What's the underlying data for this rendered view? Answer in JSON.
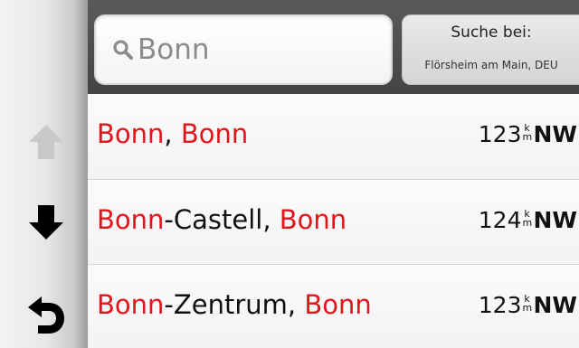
{
  "search": {
    "query": "Bonn",
    "near_label": "Suche bei:",
    "near_value": "Flörsheim am Main, DEU"
  },
  "nav": {
    "up_icon": "arrow-up-icon",
    "down_icon": "arrow-down-icon",
    "back_icon": "back-icon"
  },
  "results": [
    {
      "name_hl_1": "Bonn",
      "name_sep": ", ",
      "name_hl_2": "Bonn",
      "distance": "123",
      "unit_top": "k",
      "unit_bottom": "m",
      "direction": "NW"
    },
    {
      "name_hl_1": "Bonn",
      "name_sep": "-Castell, ",
      "name_hl_2": "Bonn",
      "distance": "124",
      "unit_top": "k",
      "unit_bottom": "m",
      "direction": "NW"
    },
    {
      "name_hl_1": "Bonn",
      "name_sep": "-Zentrum, ",
      "name_hl_2": "Bonn",
      "distance": "123",
      "unit_top": "k",
      "unit_bottom": "m",
      "direction": "NW"
    }
  ],
  "colors": {
    "highlight": "#e2151b",
    "topbar": "#4a4a4a",
    "disabled_arrow": "#c8c8c8"
  }
}
